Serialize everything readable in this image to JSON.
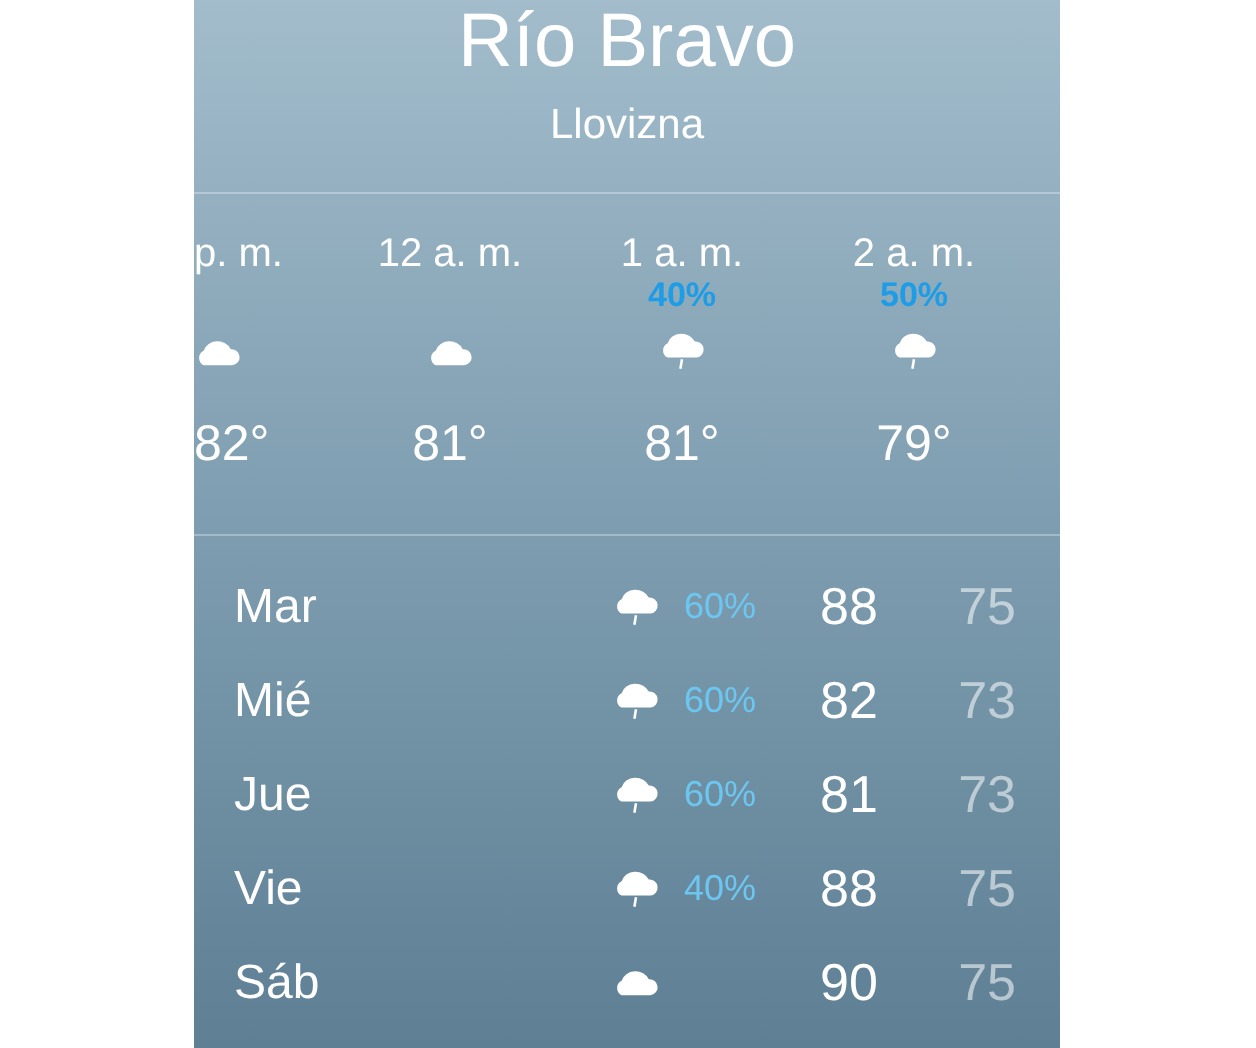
{
  "location": {
    "city": "Río Bravo",
    "condition": "Llovizna"
  },
  "hourly": [
    {
      "time": "p. m.",
      "kind": "cloud",
      "temp": "82°"
    },
    {
      "time": "12 a. m.",
      "kind": "cloud",
      "temp": "81°"
    },
    {
      "time": "1 a. m.",
      "precip": "40%",
      "kind": "rain",
      "temp": "81°"
    },
    {
      "time": "2 a. m.",
      "precip": "50%",
      "kind": "rain",
      "temp": "79°"
    }
  ],
  "daily": [
    {
      "day": "Mar",
      "kind": "rain",
      "precip": "60%",
      "high": "88",
      "low": "75"
    },
    {
      "day": "Mié",
      "kind": "rain",
      "precip": "60%",
      "high": "82",
      "low": "73"
    },
    {
      "day": "Jue",
      "kind": "rain",
      "precip": "60%",
      "high": "81",
      "low": "73"
    },
    {
      "day": "Vie",
      "kind": "rain",
      "precip": "40%",
      "high": "88",
      "low": "75"
    },
    {
      "day": "Sáb",
      "kind": "cloud",
      "high": "90",
      "low": "75"
    }
  ]
}
